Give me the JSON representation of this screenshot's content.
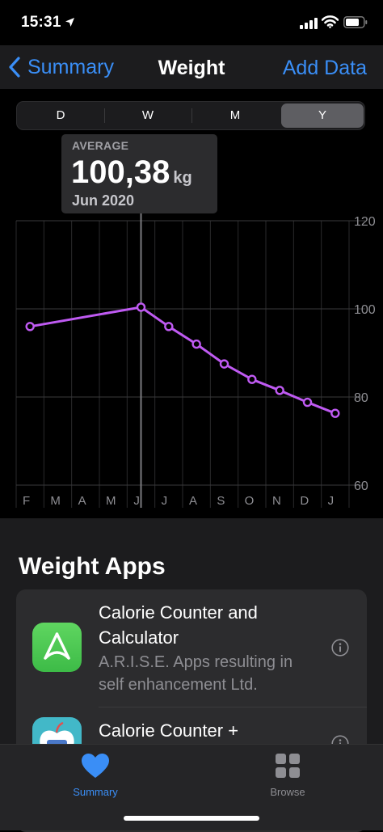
{
  "status": {
    "time": "15:31"
  },
  "nav": {
    "back_label": "Summary",
    "title": "Weight",
    "action_label": "Add Data"
  },
  "segments": [
    {
      "label": "D",
      "active": false
    },
    {
      "label": "W",
      "active": false
    },
    {
      "label": "M",
      "active": false
    },
    {
      "label": "Y",
      "active": true
    }
  ],
  "tooltip": {
    "label": "AVERAGE",
    "value": "100,38",
    "unit": "kg",
    "date": "Jun 2020"
  },
  "chart_data": {
    "type": "line",
    "categories": [
      "F",
      "M",
      "A",
      "M",
      "J",
      "J",
      "A",
      "S",
      "O",
      "N",
      "D",
      "J"
    ],
    "series": [
      {
        "values": [
          96,
          null,
          null,
          null,
          100.38,
          96,
          92,
          87.5,
          84,
          81.5,
          78.8,
          76.3
        ]
      }
    ],
    "ylim": [
      60,
      120
    ],
    "yticks": [
      "60",
      "80",
      "100",
      "120"
    ],
    "selected_index": 4,
    "grid": true,
    "line_color": "#bf5af2"
  },
  "apps_section": {
    "title": "Weight Apps",
    "apps": [
      {
        "name": "Calorie Counter and Calculator",
        "developer": "A.R.I.S.E. Apps resulting in self enhancement Ltd."
      },
      {
        "name": "Calorie Counter +",
        "developer": ""
      }
    ]
  },
  "tabs": [
    {
      "label": "Summary",
      "icon": "heart-icon",
      "active": true
    },
    {
      "label": "Browse",
      "icon": "grid-icon",
      "active": false
    }
  ],
  "colors": {
    "accent": "#3a8ef6",
    "heart": "#3a8ef6",
    "series": "#bf5af2"
  }
}
